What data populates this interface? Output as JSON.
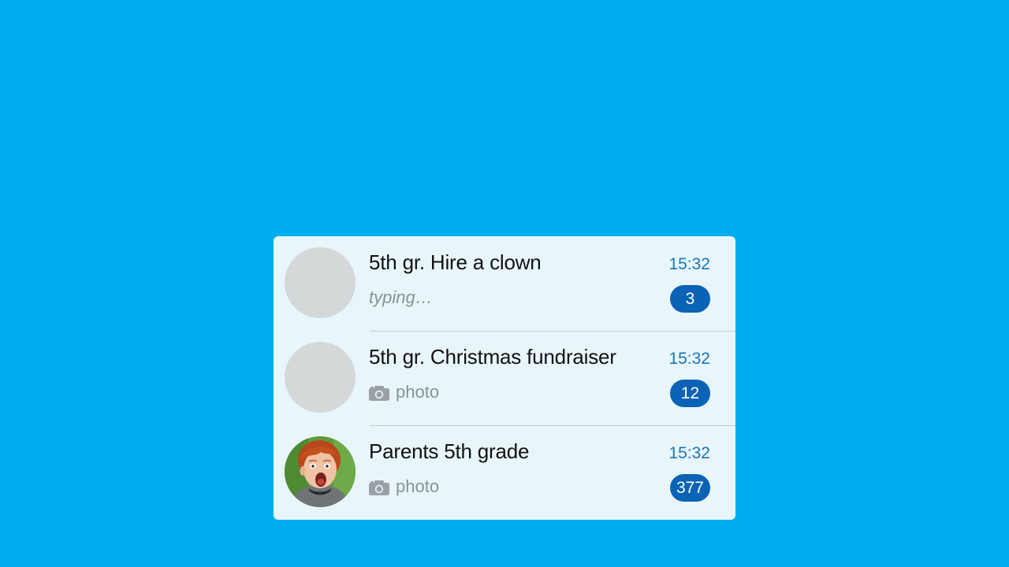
{
  "colors": {
    "background": "#00AEEF",
    "panel": "#E8F6FC",
    "time": "#1A74BC",
    "badge": "#0A63B5",
    "preview": "#8A9096"
  },
  "chats": [
    {
      "title": "5th gr. Hire a clown",
      "time": "15:32",
      "preview": "typing…",
      "preview_icon": "",
      "unread": "3",
      "avatar": "placeholder"
    },
    {
      "title": "5th gr. Christmas fundraiser",
      "time": "15:32",
      "preview": "photo",
      "preview_icon": "camera-icon",
      "unread": "12",
      "avatar": "placeholder"
    },
    {
      "title": "Parents 5th grade",
      "time": "15:32",
      "preview": "photo",
      "preview_icon": "camera-icon",
      "unread": "377",
      "avatar": "photo-of-screaming-child"
    }
  ]
}
